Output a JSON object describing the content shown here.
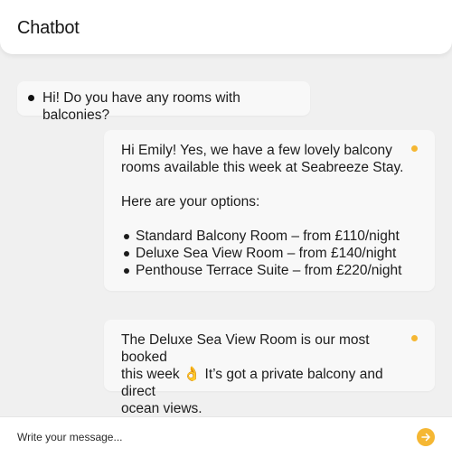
{
  "header": {
    "title": "Chatbot"
  },
  "messages": {
    "user": {
      "text": "Hi! Do you have any rooms with balconies?"
    },
    "bot1": {
      "intro_line1": "Hi Emily! Yes, we have a few lovely balcony",
      "intro_line2": "rooms available this week at Seabreeze Stay.",
      "options_heading": "Here are your options:",
      "options": [
        "Standard Balcony Room – from £110/night",
        "Deluxe Sea View Room – from £140/night",
        "Penthouse Terrace Suite – from £220/night"
      ]
    },
    "bot2": {
      "line1": "The Deluxe Sea View Room is our most booked",
      "line2": "this week 👌 It’s got a private balcony and direct",
      "line3": "ocean views."
    }
  },
  "composer": {
    "placeholder": "Write your message..."
  },
  "colors": {
    "accent": "#f5b733",
    "background": "#f0f0f0",
    "bubble": "#f8f8f8"
  },
  "icons": {
    "send": "arrow-right-icon"
  }
}
